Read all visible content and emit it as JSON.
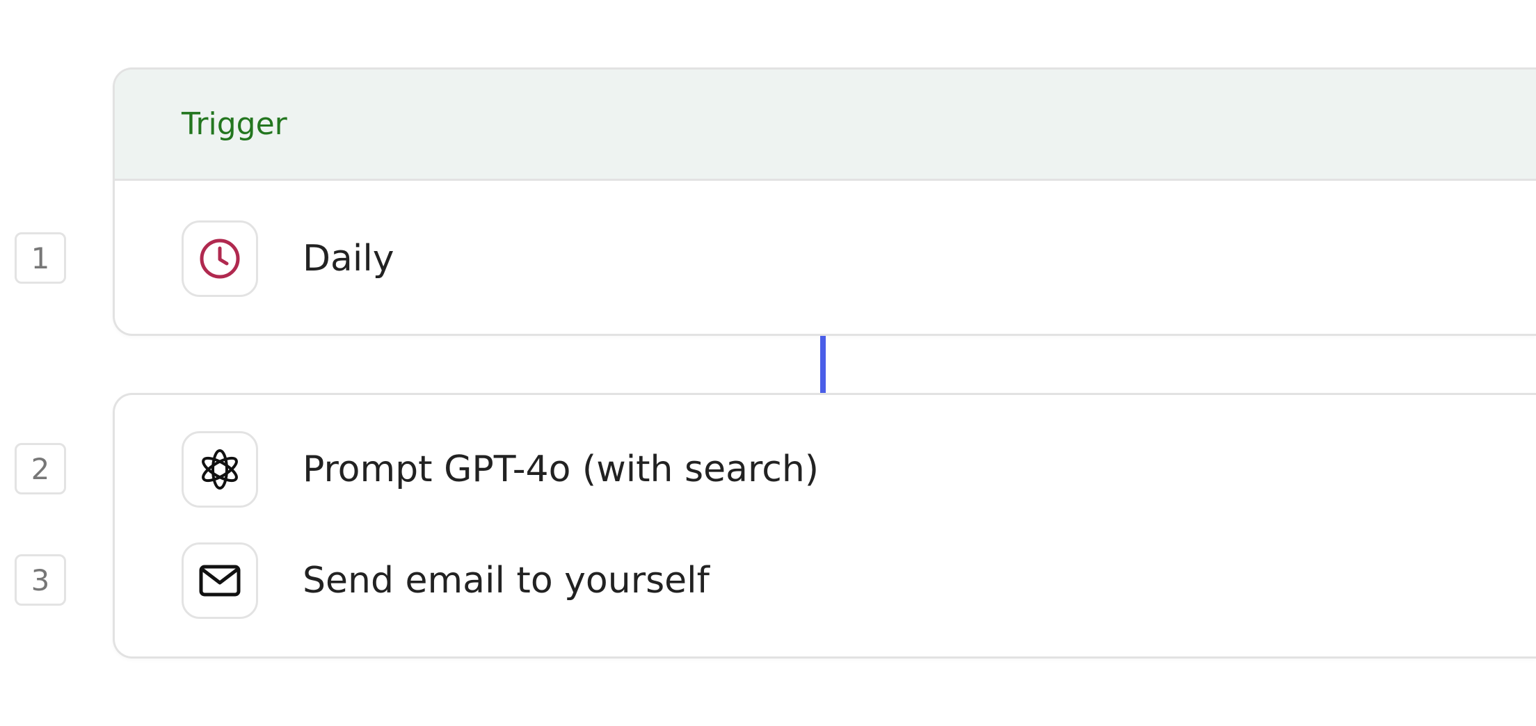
{
  "trigger": {
    "header_label": "Trigger",
    "step_number": "1",
    "label": "Daily",
    "icon": "clock-icon"
  },
  "steps": [
    {
      "number": "2",
      "label": "Prompt GPT-4o (with search)",
      "icon": "openai-icon"
    },
    {
      "number": "3",
      "label": "Send email to yourself",
      "icon": "mail-icon"
    }
  ],
  "colors": {
    "trigger_text": "#23761f",
    "trigger_header_bg": "#eef3f1",
    "clock_icon": "#b0294f",
    "connector": "#4a5ee8"
  }
}
